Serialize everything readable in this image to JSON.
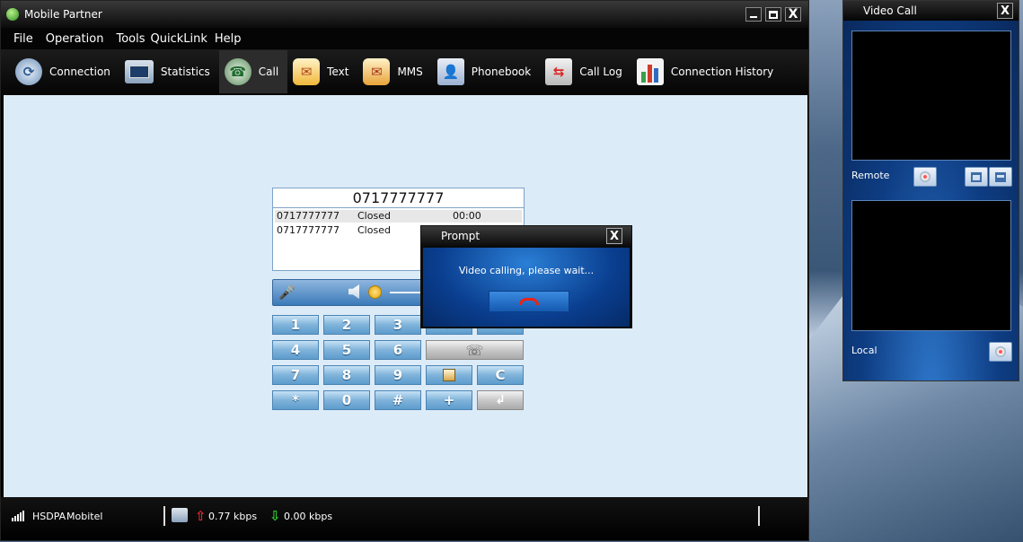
{
  "app": {
    "title": "Mobile Partner",
    "window_controls": {
      "minimize_icon": "minimize-icon",
      "maximize_icon": "maximize-icon",
      "close_label": "X"
    }
  },
  "menu": [
    "File",
    "Operation",
    "Tools",
    "QuickLink",
    "Help"
  ],
  "toolbar": [
    {
      "label": "Connection",
      "icon": "connection-icon"
    },
    {
      "label": "Statistics",
      "icon": "statistics-icon"
    },
    {
      "label": "Call",
      "icon": "call-icon"
    },
    {
      "label": "Text",
      "icon": "text-icon"
    },
    {
      "label": "MMS",
      "icon": "mms-icon"
    },
    {
      "label": "Phonebook",
      "icon": "phonebook-icon"
    },
    {
      "label": "Call Log",
      "icon": "call-log-icon"
    },
    {
      "label": "Connection History",
      "icon": "connection-history-icon"
    }
  ],
  "dialer": {
    "number": "0717777777",
    "calls": [
      {
        "number": "0717777777",
        "status": "Closed",
        "duration": "00:00"
      },
      {
        "number": "0717777777",
        "status": "Closed",
        "duration": ""
      }
    ],
    "keys": [
      "1",
      "2",
      "3",
      "4",
      "5",
      "6",
      "7",
      "8",
      "9",
      "*",
      "0",
      "#",
      "+",
      "C"
    ]
  },
  "prompt": {
    "title": "Prompt",
    "close_label": "X",
    "message": "Video calling, please wait...",
    "hangup_icon": "hangup-icon"
  },
  "status": {
    "network": "HSDPA",
    "operator": "Mobitel",
    "upload": "0.77 kbps",
    "download": "0.00 kbps"
  },
  "video_call": {
    "title": "Video Call",
    "close_label": "X",
    "remote_label": "Remote",
    "local_label": "Local"
  }
}
